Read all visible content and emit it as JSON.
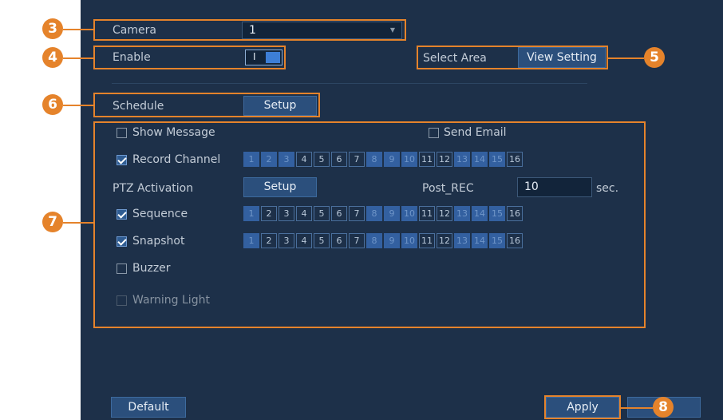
{
  "form": {
    "camera_label": "Camera",
    "camera_value": "1",
    "enable_label": "Enable",
    "enable_toggle_text": "I",
    "select_area_label": "Select Area",
    "view_setting_button": "View Setting",
    "schedule_label": "Schedule",
    "schedule_setup_button": "Setup",
    "show_message_label": "Show Message",
    "send_email_label": "Send Email",
    "record_channel_label": "Record Channel",
    "ptz_activation_label": "PTZ Activation",
    "ptz_setup_button": "Setup",
    "post_rec_label": "Post_REC",
    "post_rec_value": "10",
    "post_rec_unit": "sec.",
    "sequence_label": "Sequence",
    "snapshot_label": "Snapshot",
    "buzzer_label": "Buzzer",
    "warning_light_label": "Warning Light",
    "default_button": "Default",
    "apply_button": "Apply"
  },
  "checkboxes": {
    "show_message": false,
    "send_email": false,
    "record_channel": true,
    "sequence": true,
    "snapshot": true,
    "buzzer": false,
    "warning_light": false
  },
  "channels": [
    "1",
    "2",
    "3",
    "4",
    "5",
    "6",
    "7",
    "8",
    "9",
    "10",
    "11",
    "12",
    "13",
    "14",
    "15",
    "16"
  ],
  "channel_rows": {
    "record_channel": [
      true,
      true,
      true,
      false,
      false,
      false,
      false,
      true,
      true,
      true,
      false,
      false,
      true,
      true,
      true,
      false
    ],
    "sequence": [
      true,
      false,
      false,
      false,
      false,
      false,
      false,
      true,
      true,
      true,
      false,
      false,
      true,
      true,
      true,
      false
    ],
    "snapshot": [
      true,
      false,
      false,
      false,
      false,
      false,
      false,
      true,
      true,
      true,
      false,
      false,
      true,
      true,
      true,
      false
    ]
  },
  "callouts": [
    "3",
    "4",
    "5",
    "6",
    "7",
    "8"
  ],
  "colors": {
    "panel": "#1d3049",
    "highlight": "#e5832b",
    "button": "#2b4f7c"
  }
}
